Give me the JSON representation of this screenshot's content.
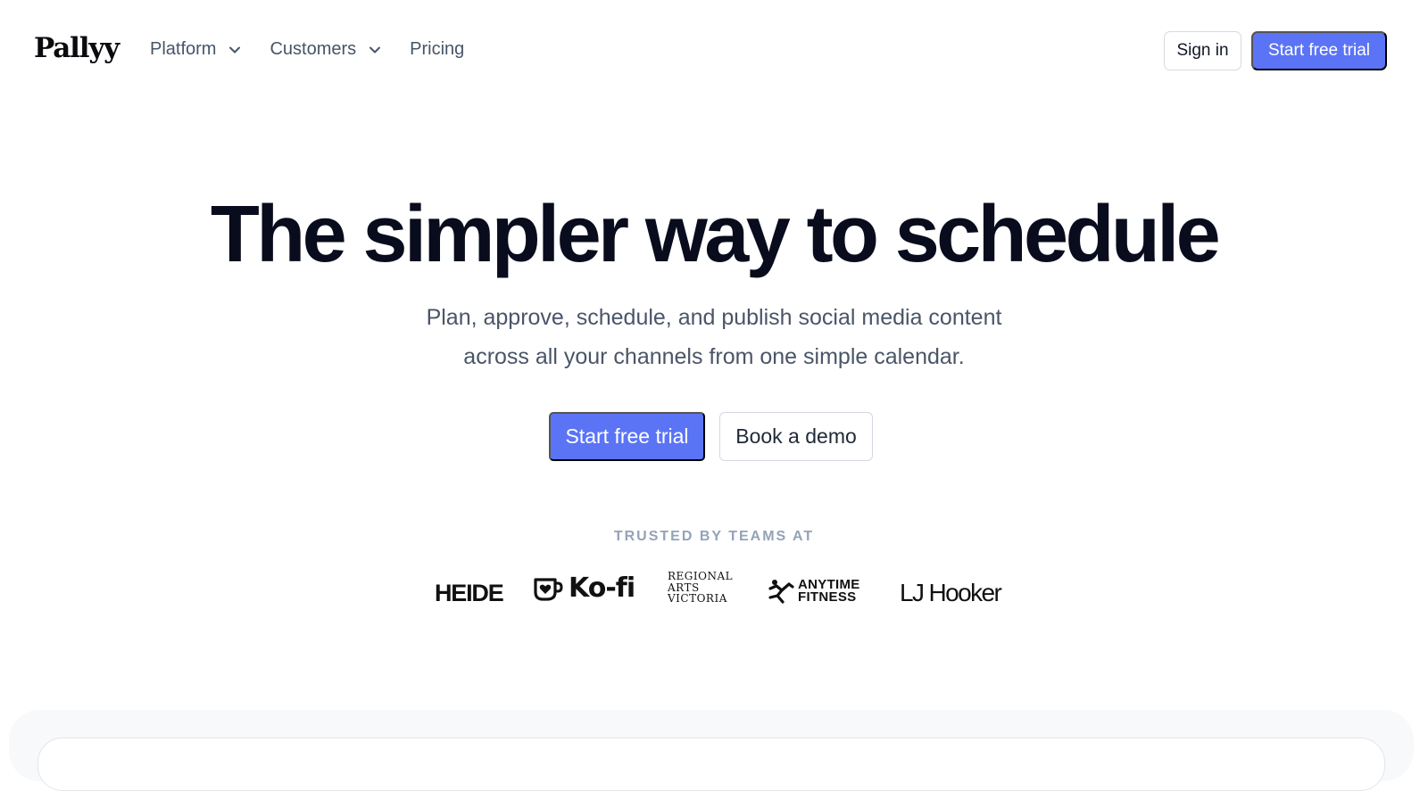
{
  "nav": {
    "logo": "Pallyy",
    "links": [
      {
        "label": "Platform",
        "has_dropdown": true,
        "icon": "chevron-down-icon"
      },
      {
        "label": "Customers",
        "has_dropdown": true,
        "icon": "chevron-down-icon"
      },
      {
        "label": "Pricing",
        "has_dropdown": false
      }
    ],
    "sign_in": "Sign in",
    "start_trial": "Start free trial"
  },
  "hero": {
    "title": "The simpler way to schedule",
    "subtitle_line1": "Plan, approve, schedule, and publish social media content",
    "subtitle_line2": "across all your channels from one simple calendar.",
    "cta_primary": "Start free trial",
    "cta_secondary": "Book a demo"
  },
  "trusted": {
    "label": "TRUSTED BY TEAMS AT",
    "logos": [
      {
        "name": "HEIDE"
      },
      {
        "name": "Ko-fi",
        "icon": "kofi-cup-heart-icon"
      },
      {
        "name": "Regional Arts Victoria",
        "lines": [
          "REGIONAL",
          "ARTS",
          "VICTORIA"
        ]
      },
      {
        "name": "Anytime Fitness",
        "lines": [
          "ANYTIME",
          "FITNESS"
        ],
        "icon": "running-man-icon"
      },
      {
        "name": "LJ Hooker"
      }
    ]
  },
  "colors": {
    "accent": "#5b74f5",
    "heading": "#080c1d",
    "body_text": "#4a5568",
    "muted": "#94a3b8",
    "border": "#d4d8df"
  }
}
